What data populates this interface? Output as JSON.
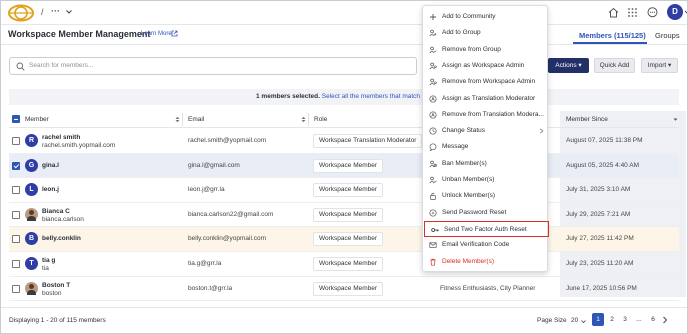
{
  "topbar": {
    "breadcrumb_separator": "/",
    "breadcrumb_more": "···",
    "user_initial": "D"
  },
  "header": {
    "title": "Workspace Member Management",
    "learn_more": "Learn More",
    "tabs": [
      {
        "label": "Members (115/125)",
        "active": true
      },
      {
        "label": "Groups",
        "active": false
      }
    ]
  },
  "toolbar": {
    "search_placeholder": "Search for members...",
    "actions_label": "Actions ▾",
    "quick_add_label": "Quick Add",
    "import_label": "Import ▾"
  },
  "banner": {
    "selected_text": "1 members selected.",
    "select_all_text": "Select all the members that match this"
  },
  "table": {
    "columns": [
      "Member",
      "Email",
      "Role",
      "Member Since"
    ],
    "rows": [
      {
        "initial": "R",
        "name": "rachel smith",
        "username": "rachel.smith.yopmail.com",
        "email": "rachel.smith@yopmail.com",
        "role": "Workspace Translation Moderator",
        "groups": "",
        "since": "August 07, 2025 11:38 PM",
        "checked": false,
        "avatar": "letter"
      },
      {
        "initial": "G",
        "name": "gina.l",
        "username": "",
        "email": "gina.l@gmail.com",
        "role": "Workspace Member",
        "groups": "",
        "since": "August 05, 2025 4:40 AM",
        "checked": true,
        "avatar": "letter"
      },
      {
        "initial": "L",
        "name": "leon.j",
        "username": "",
        "email": "leon.j@grr.la",
        "role": "Workspace Member",
        "groups": "",
        "since": "July 31, 2025 3:10 AM",
        "checked": false,
        "avatar": "letter"
      },
      {
        "initial": "",
        "name": "Bianca C",
        "username": "bianca.carlson",
        "email": "bianca.carlson22@gmail.com",
        "role": "Workspace Member",
        "groups": "",
        "since": "July 29, 2025 7:21 AM",
        "checked": false,
        "avatar": "photo"
      },
      {
        "initial": "B",
        "name": "belly.conklin",
        "username": "",
        "email": "belly.conklin@yopmail.com",
        "role": "Workspace Member",
        "groups": "",
        "since": "July 27, 2025 11:42 PM",
        "checked": false,
        "avatar": "letter"
      },
      {
        "initial": "T",
        "name": "tia g",
        "username": "tia",
        "email": "tia.g@grr.la",
        "role": "Workspace Member",
        "groups": "",
        "since": "July 23, 2025 11:20 AM",
        "checked": false,
        "avatar": "letter"
      },
      {
        "initial": "",
        "name": "Boston T",
        "username": "boston",
        "email": "boston.t@grr.la",
        "role": "Workspace Member",
        "groups": "Fitness Enthusiasts, City Planner",
        "since": "June 17, 2025 10:56 PM",
        "checked": false,
        "avatar": "photo"
      }
    ]
  },
  "footer": {
    "displaying": "Displaying 1 - 20 of 115 members",
    "page_size_label": "Page Size",
    "page_size_value": "20",
    "pages": [
      "1",
      "2",
      "3",
      "...",
      "6"
    ],
    "current_page": "1"
  },
  "menu": {
    "items": [
      {
        "icon": "plus-icon",
        "label": "Add to Community"
      },
      {
        "icon": "group-icon",
        "label": "Add to Group"
      },
      {
        "icon": "group-icon",
        "label": "Remove from Group"
      },
      {
        "icon": "admin-icon",
        "label": "Assign as Workspace Admin"
      },
      {
        "icon": "admin-icon",
        "label": "Remove from Workspace Admin"
      },
      {
        "icon": "translate-icon",
        "label": "Assign as Translation Moderator"
      },
      {
        "icon": "translate-icon",
        "label": "Remove from Translation Modera..."
      },
      {
        "icon": "status-icon",
        "label": "Change Status"
      },
      {
        "icon": "message-icon",
        "label": "Message"
      },
      {
        "icon": "ban-icon",
        "label": "Ban Member(s)"
      },
      {
        "icon": "unban-icon",
        "label": "Unban Member(s)"
      },
      {
        "icon": "unlock-icon",
        "label": "Unlock Member(s)"
      },
      {
        "icon": "password-icon",
        "label": "Send Password Reset"
      },
      {
        "icon": "key-icon",
        "label": "Send Two Factor Auth Reset"
      },
      {
        "icon": "email-icon",
        "label": "Email Verification Code"
      },
      {
        "icon": "trash-icon",
        "label": "Delete Member(s)"
      }
    ]
  },
  "colors": {
    "brand_dark": "#233068",
    "accent_blue": "#2f55b5",
    "avatar_blue": "#2f3da5",
    "danger_red": "#d93025",
    "highlight_row": "#fdf6e8",
    "selected_row": "#e9edf6"
  }
}
